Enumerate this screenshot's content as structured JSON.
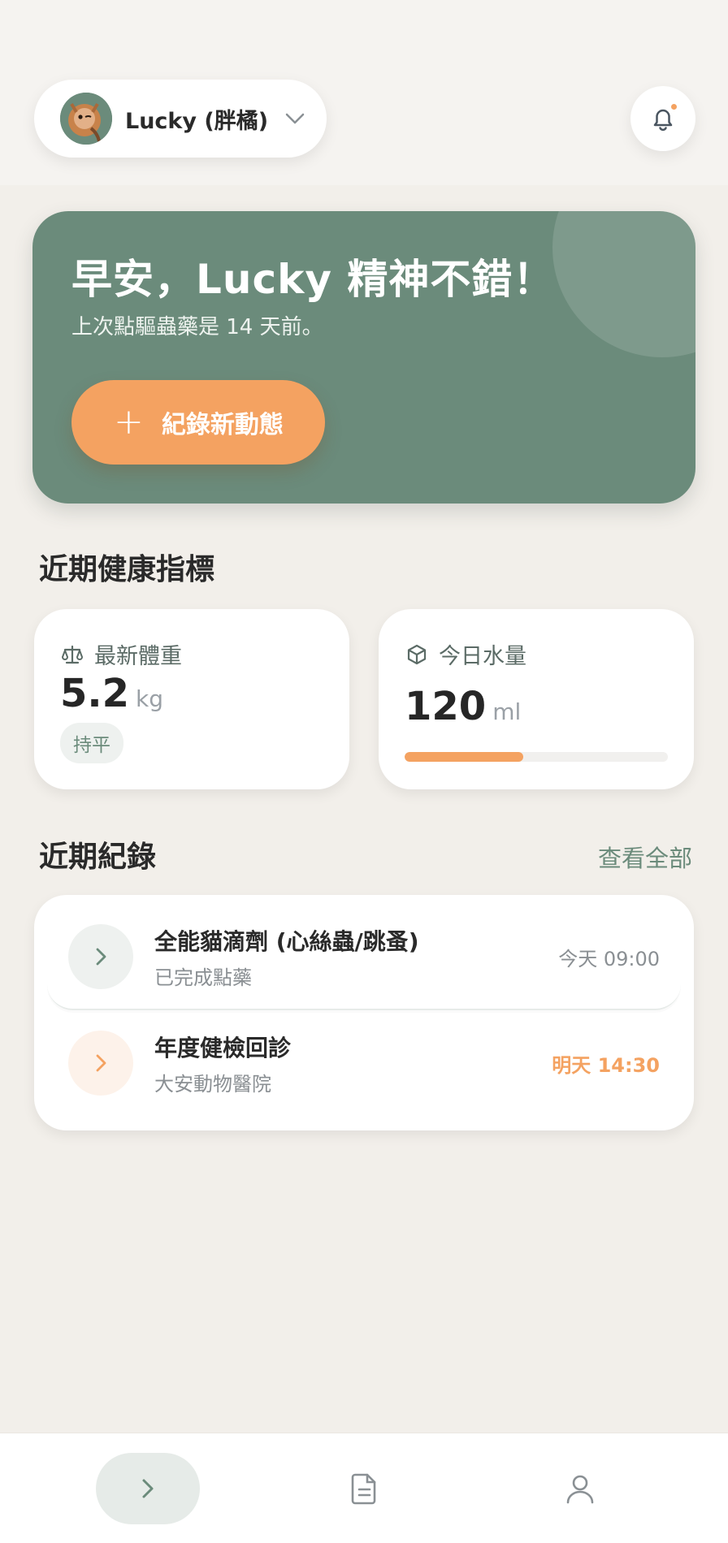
{
  "header": {
    "pet_name": "Lucky (胖橘)",
    "has_notification": true
  },
  "hero": {
    "greeting": "早安，Lucky 精神不錯！",
    "subtitle": "上次點驅蟲藥是 14 天前。",
    "cta_plus": "+",
    "cta_label": "紀錄新動態"
  },
  "health": {
    "section_title": "近期健康指標",
    "weight": {
      "label": "最新體重",
      "icon": "scale-icon",
      "value": "5.2",
      "unit": "kg",
      "trend": "持平"
    },
    "water": {
      "label": "今日水量",
      "icon": "box-icon",
      "value": "120",
      "unit": "ml",
      "progress_fraction": 0.45
    }
  },
  "records": {
    "section_title": "近期紀錄",
    "view_all": "查看全部",
    "items": [
      {
        "title": "全能貓滴劑 (心絲蟲/跳蚤)",
        "subtitle": "已完成點藥",
        "time": "今天 09:00",
        "icon": "chevron-right-icon"
      },
      {
        "title": "年度健檢回診",
        "subtitle": "大安動物醫院",
        "time": "明天 14:30",
        "icon": "chevron-right-icon"
      }
    ]
  },
  "nav": {
    "items": [
      {
        "name": "home",
        "icon": "chevron-right-icon",
        "active": true
      },
      {
        "name": "records",
        "icon": "document-icon",
        "active": false
      },
      {
        "name": "profile",
        "icon": "user-icon",
        "active": false
      }
    ]
  },
  "colors": {
    "brand_green": "#6b8b7b",
    "accent_orange": "#f4a261",
    "background": "#f2efea"
  }
}
